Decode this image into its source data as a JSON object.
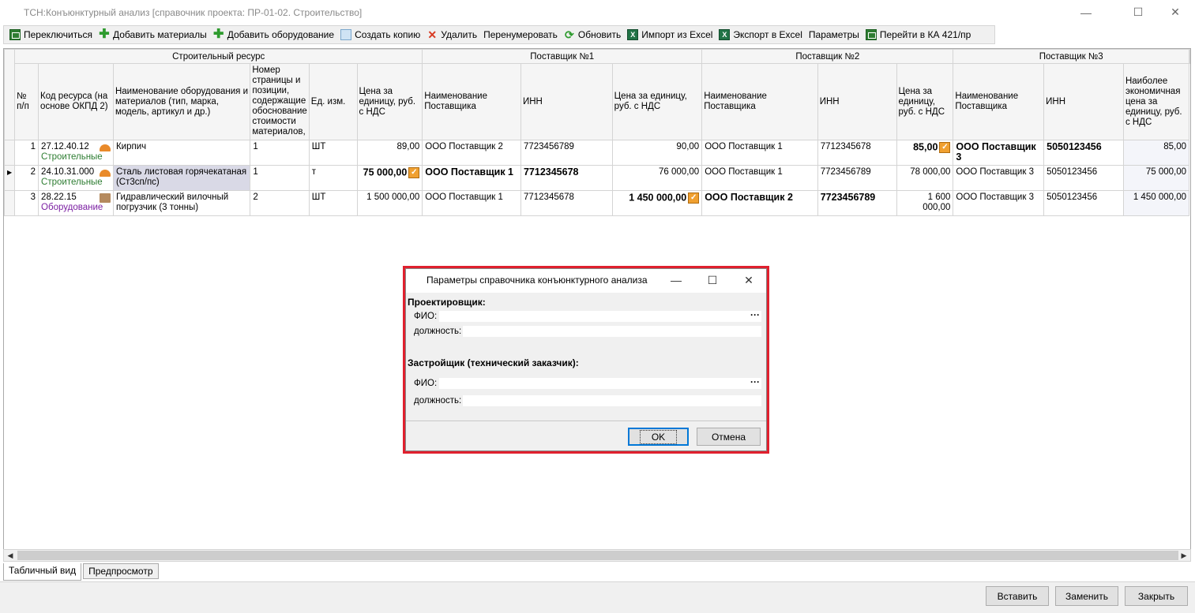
{
  "window": {
    "title": "ТСН:Конъюнктурный анализ [справочник проекта: ПР-01-02. Строительство]",
    "minimize": "—",
    "maximize": "☐",
    "close": "✕"
  },
  "toolbar": [
    {
      "label": "Переключиться",
      "icon": "switch-sheet-icon"
    },
    {
      "label": "Добавить материалы",
      "icon": "plus-icon"
    },
    {
      "label": "Добавить оборудование",
      "icon": "plus-icon"
    },
    {
      "label": "Создать копию",
      "icon": "copy-icon"
    },
    {
      "label": "Удалить",
      "icon": "delete-x-icon"
    },
    {
      "label": "Перенумеровать",
      "icon": ""
    },
    {
      "label": "Обновить",
      "icon": "refresh-icon"
    },
    {
      "label": "Импорт из Excel",
      "icon": "excel-icon"
    },
    {
      "label": "Экспорт в Excel",
      "icon": "excel-icon"
    },
    {
      "label": "Параметры",
      "icon": ""
    },
    {
      "label": "Перейти в КА 421/пр",
      "icon": "switch-sheet-icon"
    }
  ],
  "grid": {
    "groups": {
      "resource": "Строительный ресурс",
      "supplier1": "Поставщик №1",
      "supplier2": "Поставщик №2",
      "supplier3": "Поставщик №3"
    },
    "columns": {
      "num": "№ п/п",
      "code": "Код ресурса (на основе ОКПД 2)",
      "name": "Наименование оборудования и материалов (тип, марка, модель, артикул и др.)",
      "page": "Номер страницы и позиции, содержащие обоснование стоимости материалов,",
      "unit": "Ед. изм.",
      "s1_price": "Цена за единицу, руб. с НДС",
      "s1_name": "Наименование Поставщика",
      "s1_inn": "ИНН",
      "s2_price": "Цена за единицу, руб. с НДС",
      "s2_name": "Наименование Поставщика",
      "s2_inn": "ИНН",
      "s3_price": "Цена за единицу, руб. с НДС",
      "s3_name": "Наименование Поставщика",
      "s3_inn": "ИНН",
      "econ": "Наиболее экономичная цена за единицу, руб. с НДС"
    },
    "rows": [
      {
        "num": "1",
        "code": "27.12.40.12",
        "category": "Строительные",
        "name": "Кирпич",
        "page": "1",
        "unit": "ШТ",
        "s1_price": "89,00",
        "s1_name": "ООО Поставщик 2",
        "s1_inn": "7723456789",
        "s2_price": "90,00",
        "s2_name": "ООО Поставщик 1",
        "s2_inn": "7712345678",
        "s3_price": "85,00",
        "s3_name": "ООО Поставщик 3",
        "s3_inn": "5050123456",
        "econ": "85,00"
      },
      {
        "num": "2",
        "code": "24.10.31.000",
        "category": "Строительные",
        "name": "Сталь листовая горячекатаная (Ст3сп/пс)",
        "page": "1",
        "unit": "т",
        "s1_price": "75 000,00",
        "s1_name": "ООО Поставщик 1",
        "s1_inn": "7712345678",
        "s2_price": "76 000,00",
        "s2_name": "ООО Поставщик 1",
        "s2_inn": "7723456789",
        "s3_price": "78 000,00",
        "s3_name": "ООО Поставщик 3",
        "s3_inn": "5050123456",
        "econ": "75 000,00"
      },
      {
        "num": "3",
        "code": "28.22.15",
        "category": "Оборудование",
        "name": "Гидравлический вилочный погрузчик (3 тонны)",
        "page": "2",
        "unit": "ШТ",
        "s1_price": "1 500 000,00",
        "s1_name": "ООО Поставщик 1",
        "s1_inn": "7712345678",
        "s2_price": "1 450 000,00",
        "s2_name": "ООО Поставщик 2",
        "s2_inn": "7723456789",
        "s3_price": "1 600 000,00",
        "s3_name": "ООО Поставщик 3",
        "s3_inn": "5050123456",
        "econ": "1 450 000,00"
      }
    ]
  },
  "tabs": [
    "Табличный вид",
    "Предпросмотр"
  ],
  "footer": {
    "insert": "Вставить",
    "replace": "Заменить",
    "close": "Закрыть"
  },
  "dialog": {
    "title": "Параметры справочника конъюнктурного анализа",
    "designer_header": "Проектировщик:",
    "developer_header": "Застройщик (технический заказчик):",
    "fio_label": "ФИО:",
    "position_label": "должность:",
    "designer_fio": "",
    "designer_position": "",
    "developer_fio": "",
    "developer_position": "",
    "ellipsis": "···",
    "ok": "OK",
    "cancel": "Отмена",
    "minimize": "—",
    "maximize": "☐",
    "close": "✕"
  },
  "colors": {
    "highlight_border": "#e0202e",
    "category_build": "#2e7d32",
    "category_equipment": "#7b1fa2"
  }
}
